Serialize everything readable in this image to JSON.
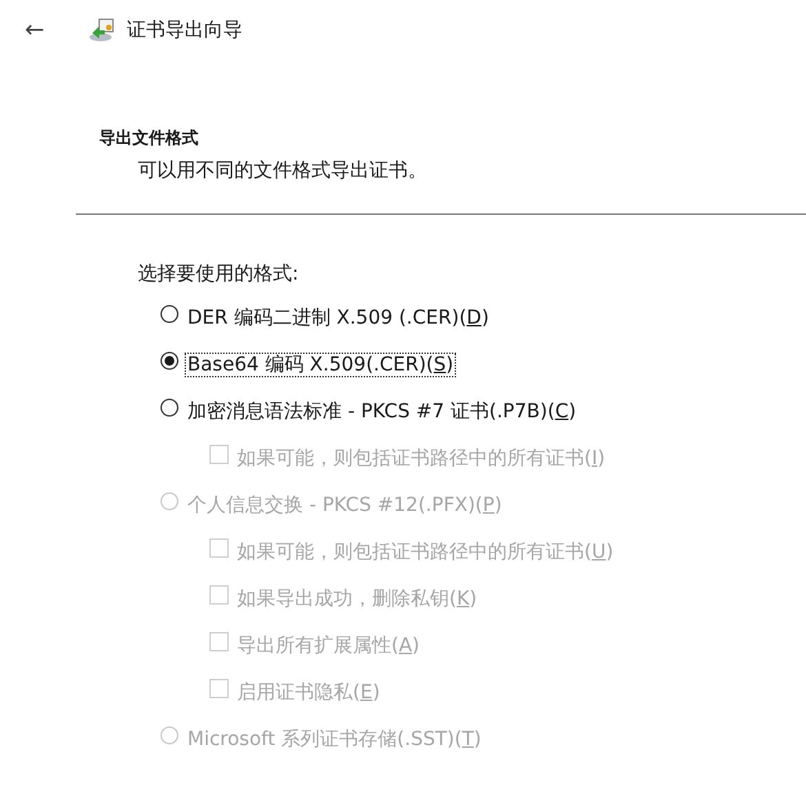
{
  "header": {
    "back": "←",
    "title": "证书导出向导"
  },
  "page": {
    "heading": "导出文件格式",
    "description": "可以用不同的文件格式导出证书。"
  },
  "prompt": "选择要使用的格式:",
  "options": [
    {
      "kind": "radio",
      "before": "DER 编码二进制 X.509 (.CER)(",
      "key": "D",
      "after": ")",
      "selected": false,
      "disabled": false,
      "focused": false
    },
    {
      "kind": "radio",
      "before": "Base64 编码 X.509(.CER)(",
      "key": "S",
      "after": ")",
      "selected": true,
      "disabled": false,
      "focused": true
    },
    {
      "kind": "radio",
      "before": "加密消息语法标准 - PKCS #7 证书(.P7B)(",
      "key": "C",
      "after": ")",
      "selected": false,
      "disabled": false,
      "focused": false
    },
    {
      "kind": "checkbox",
      "before": "如果可能，则包括证书路径中的所有证书(",
      "key": "I",
      "after": ")",
      "checked": false,
      "disabled": true,
      "focused": false
    },
    {
      "kind": "radio",
      "before": "个人信息交换 - PKCS #12(.PFX)(",
      "key": "P",
      "after": ")",
      "selected": false,
      "disabled": true,
      "focused": false
    },
    {
      "kind": "checkbox",
      "before": "如果可能，则包括证书路径中的所有证书(",
      "key": "U",
      "after": ")",
      "checked": false,
      "disabled": true,
      "focused": false
    },
    {
      "kind": "checkbox",
      "before": "如果导出成功，删除私钥(",
      "key": "K",
      "after": ")",
      "checked": false,
      "disabled": true,
      "focused": false
    },
    {
      "kind": "checkbox",
      "before": "导出所有扩展属性(",
      "key": "A",
      "after": ")",
      "checked": false,
      "disabled": true,
      "focused": false
    },
    {
      "kind": "checkbox",
      "before": "启用证书隐私(",
      "key": "E",
      "after": ")",
      "checked": false,
      "disabled": true,
      "focused": false
    },
    {
      "kind": "radio",
      "before": "Microsoft 系列证书存储(.SST)(",
      "key": "T",
      "after": ")",
      "selected": false,
      "disabled": true,
      "focused": false
    }
  ]
}
